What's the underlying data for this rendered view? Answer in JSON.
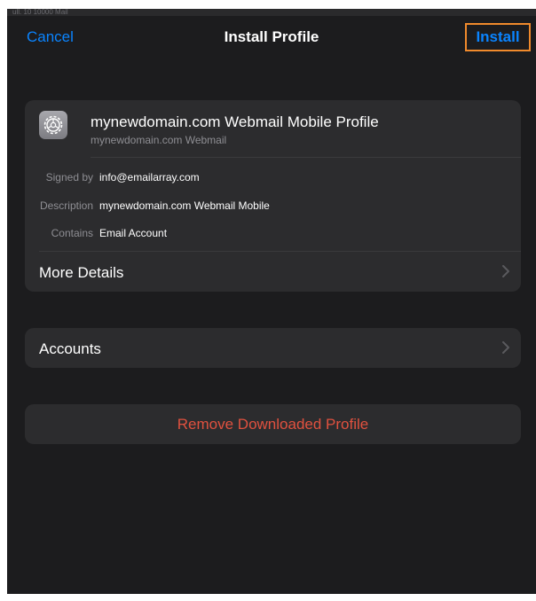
{
  "status_strip": "ull. 10 10000 Mail",
  "nav": {
    "cancel_label": "Cancel",
    "title": "Install Profile",
    "install_label": "Install"
  },
  "profile": {
    "icon": "gear-icon",
    "name": "mynewdomain.com Webmail Mobile Profile",
    "subtitle": "mynewdomain.com Webmail",
    "details": [
      {
        "label": "Signed by",
        "value": "info@emailarray.com"
      },
      {
        "label": "Description",
        "value": "mynewdomain.com Webmail Mobile"
      },
      {
        "label": "Contains",
        "value": "Email Account"
      }
    ],
    "more_details_label": "More Details"
  },
  "accounts_label": "Accounts",
  "remove_label": "Remove Downloaded Profile",
  "colors": {
    "background": "#1c1c1e",
    "card": "#2c2c2e",
    "accent_blue": "#0a84ff",
    "destructive_red": "#e0513f",
    "highlight_orange": "#f08a2c"
  }
}
